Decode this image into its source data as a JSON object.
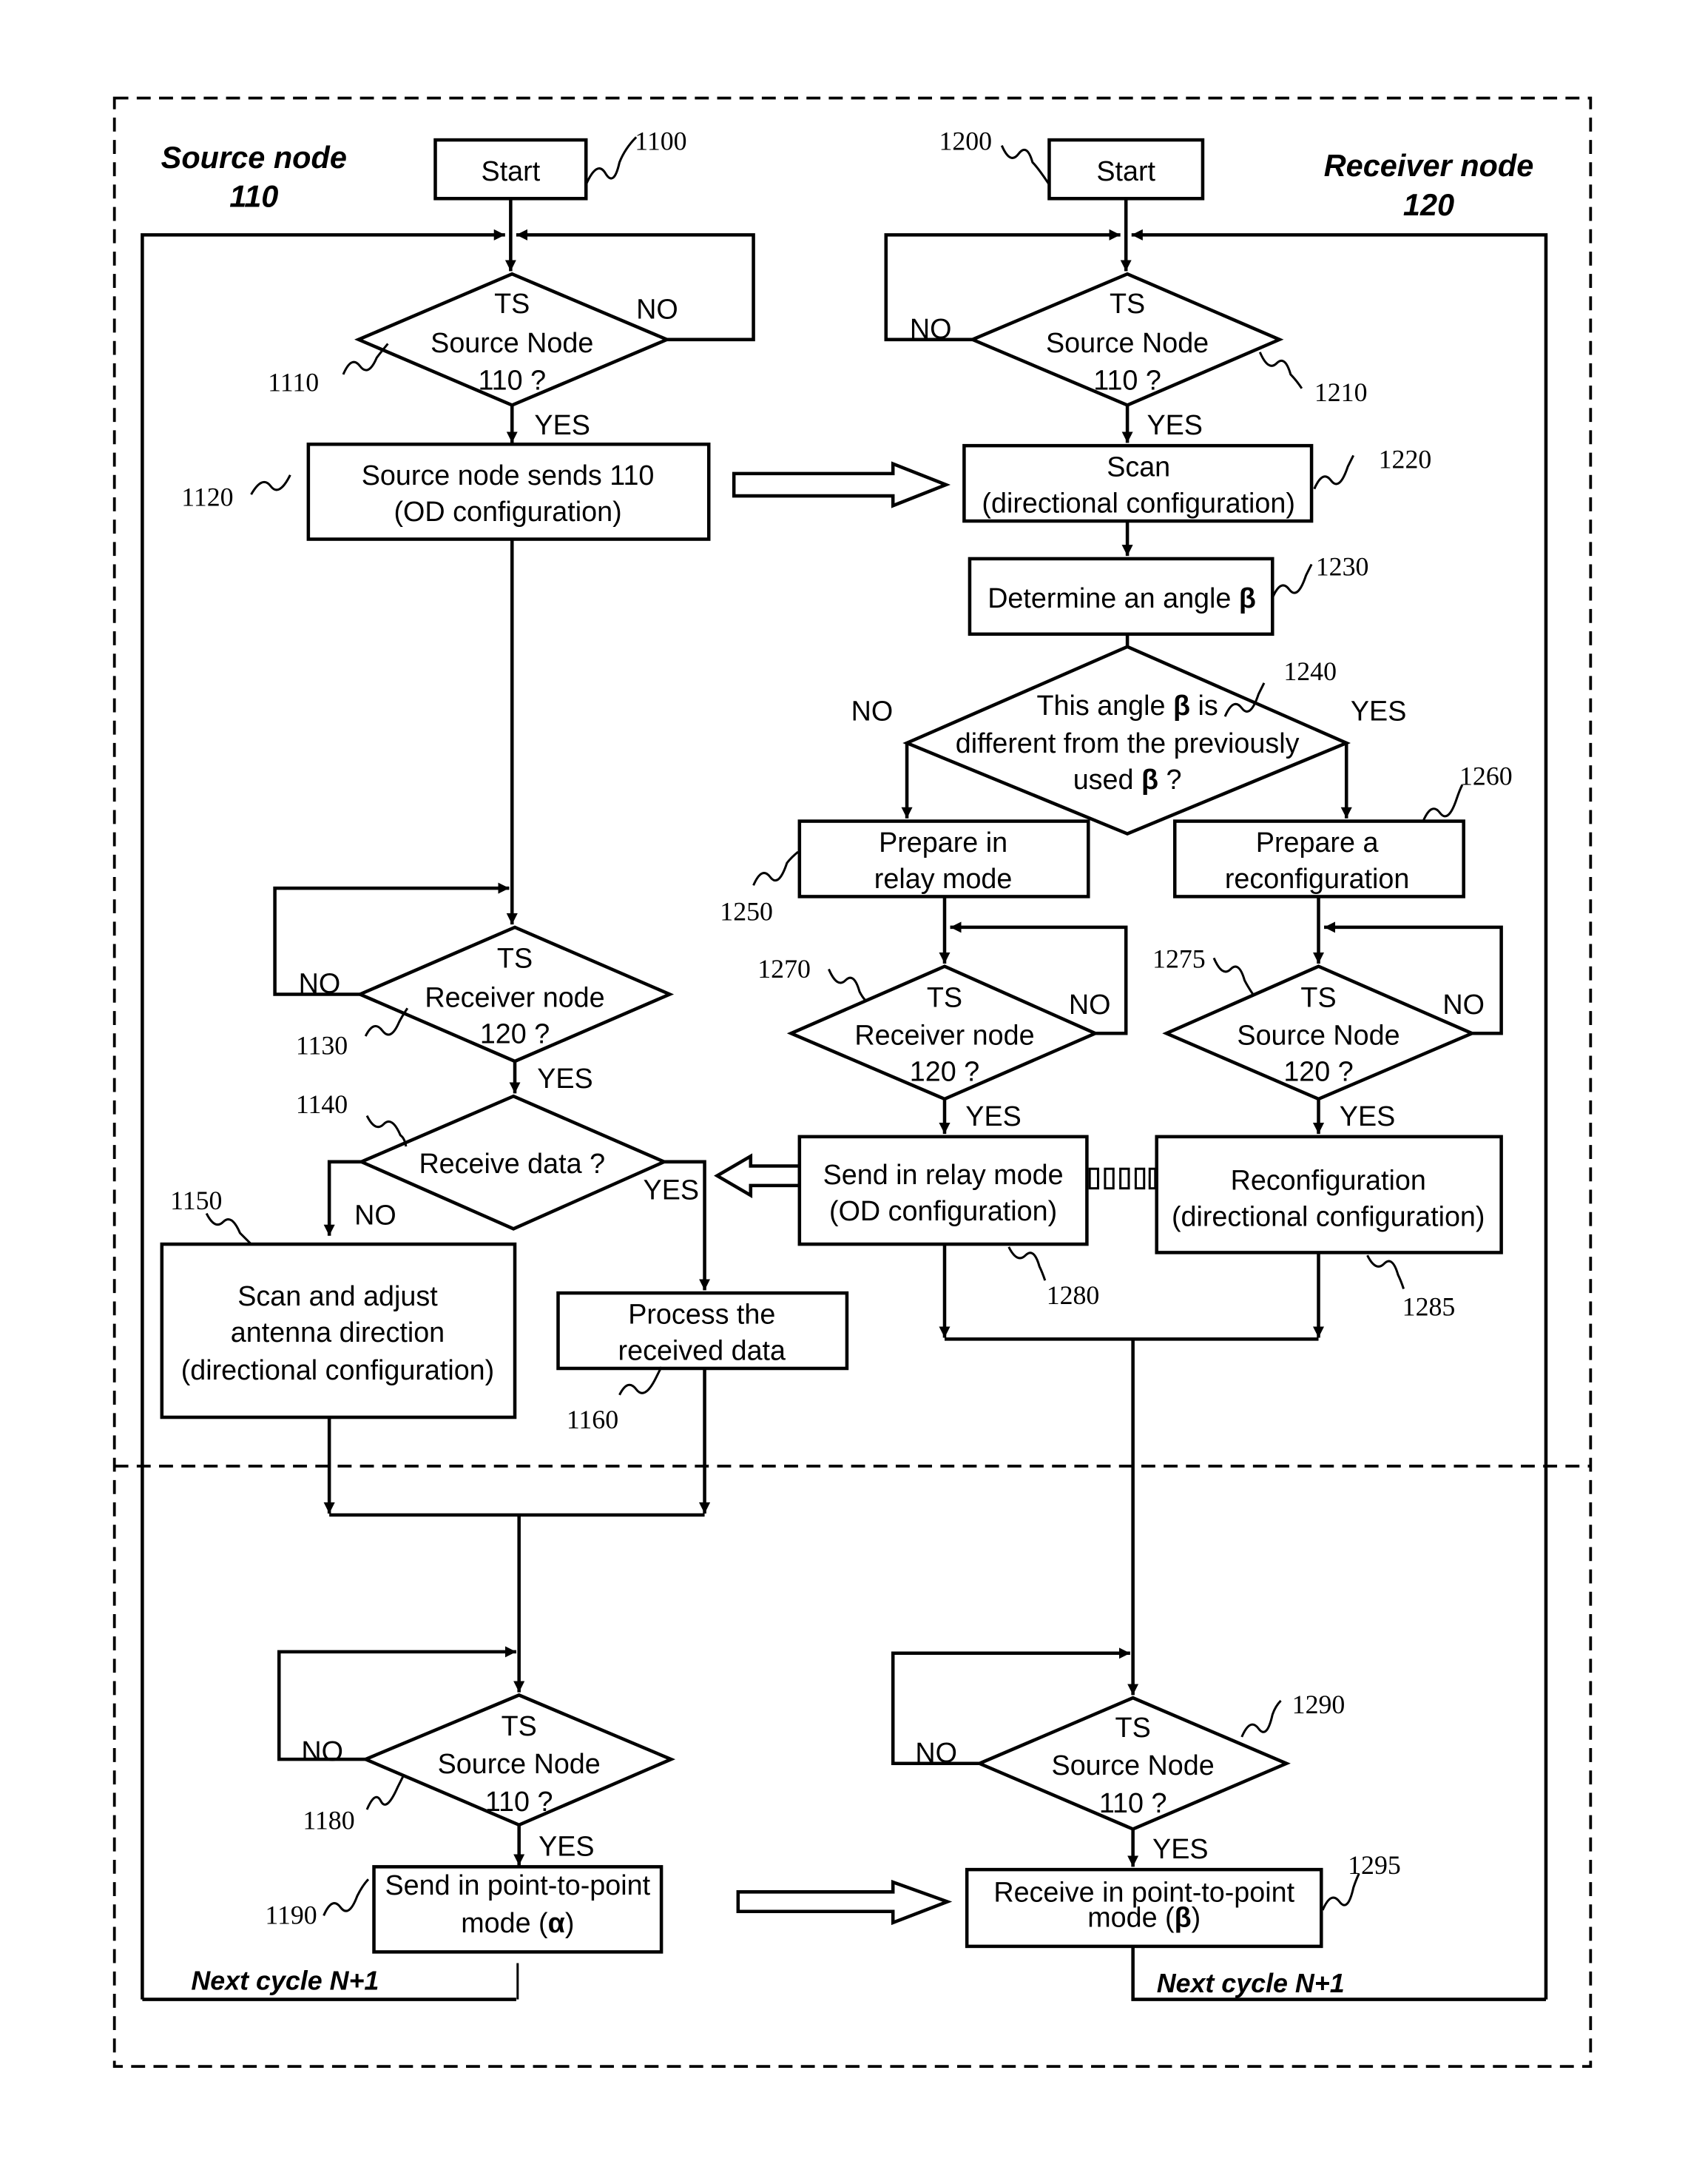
{
  "regions": {
    "source_title_line1": "Source node",
    "source_title_line2": "110",
    "receiver_title_line1": "Receiver node",
    "receiver_title_line2": "120"
  },
  "source_flow": {
    "start": {
      "ref": "1100",
      "label": "Start"
    },
    "d1110": {
      "ref": "1110",
      "line1": "TS",
      "line2": "Source Node",
      "line3": "110 ?",
      "yes": "YES",
      "no": "NO"
    },
    "b1120": {
      "ref": "1120",
      "line1": "Source node sends 110",
      "line2": "(OD configuration)"
    },
    "d1130": {
      "ref": "1130",
      "line1": "TS",
      "line2": "Receiver node",
      "line3": "120 ?",
      "yes": "YES",
      "no": "NO"
    },
    "d1140": {
      "ref": "1140",
      "line1": "Receive data ?",
      "yes": "YES",
      "no": "NO"
    },
    "b1150": {
      "ref": "1150",
      "line1": "Scan and adjust",
      "line2": "antenna direction",
      "line3": "(directional configuration)"
    },
    "b1160": {
      "ref": "1160",
      "line1": "Process the",
      "line2": "received data"
    },
    "d1180": {
      "ref": "1180",
      "line1": "TS",
      "line2": "Source Node",
      "line3": "110 ?",
      "yes": "YES",
      "no": "NO"
    },
    "b1190": {
      "ref": "1190",
      "line1": "Send in point-to-point",
      "line2_prefix": "mode (",
      "line2_symbol": "α",
      "line2_suffix": ")"
    },
    "next_cycle": "Next cycle N+1"
  },
  "receiver_flow": {
    "start": {
      "ref": "1200",
      "label": "Start"
    },
    "d1210": {
      "ref": "1210",
      "line1": "TS",
      "line2": "Source Node",
      "line3": "110 ?",
      "yes": "YES",
      "no": "NO"
    },
    "b1220": {
      "ref": "1220",
      "line1": "Scan",
      "line2": "(directional configuration)"
    },
    "b1230": {
      "ref": "1230",
      "line1_prefix": "Determine an angle ",
      "symbol": "β"
    },
    "d1240": {
      "ref": "1240",
      "line1_prefix": "This angle ",
      "symbol": "β",
      "line1_suffix": " is",
      "line2": "different from the previously",
      "line3_prefix": "used ",
      "line3_suffix": " ?",
      "yes": "YES",
      "no": "NO"
    },
    "b1250": {
      "ref": "1250",
      "line1": "Prepare in",
      "line2": "relay mode"
    },
    "b1260": {
      "ref": "1260",
      "line1": "Prepare a",
      "line2": "reconfiguration"
    },
    "d1270": {
      "ref": "1270",
      "line1": "TS",
      "line2": "Receiver node",
      "line3": "120 ?",
      "yes": "YES",
      "no": "NO"
    },
    "d1275": {
      "ref": "1275",
      "line1": "TS",
      "line2": "Source Node",
      "line3": "120 ?",
      "yes": "YES",
      "no": "NO"
    },
    "b1280": {
      "ref": "1280",
      "line1": "Send in relay mode",
      "line2": "(OD configuration)"
    },
    "b1285": {
      "ref": "1285",
      "line1": "Reconfiguration",
      "line2": "(directional configuration)"
    },
    "d1290": {
      "ref": "1290",
      "line1": "TS",
      "line2": "Source Node",
      "line3": "110 ?",
      "yes": "YES",
      "no": "NO"
    },
    "b1295": {
      "ref": "1295",
      "line1": "Receive in point-to-point",
      "line2_prefix": "mode (",
      "line2_symbol": "β",
      "line2_suffix": ")"
    },
    "next_cycle": "Next cycle N+1"
  }
}
